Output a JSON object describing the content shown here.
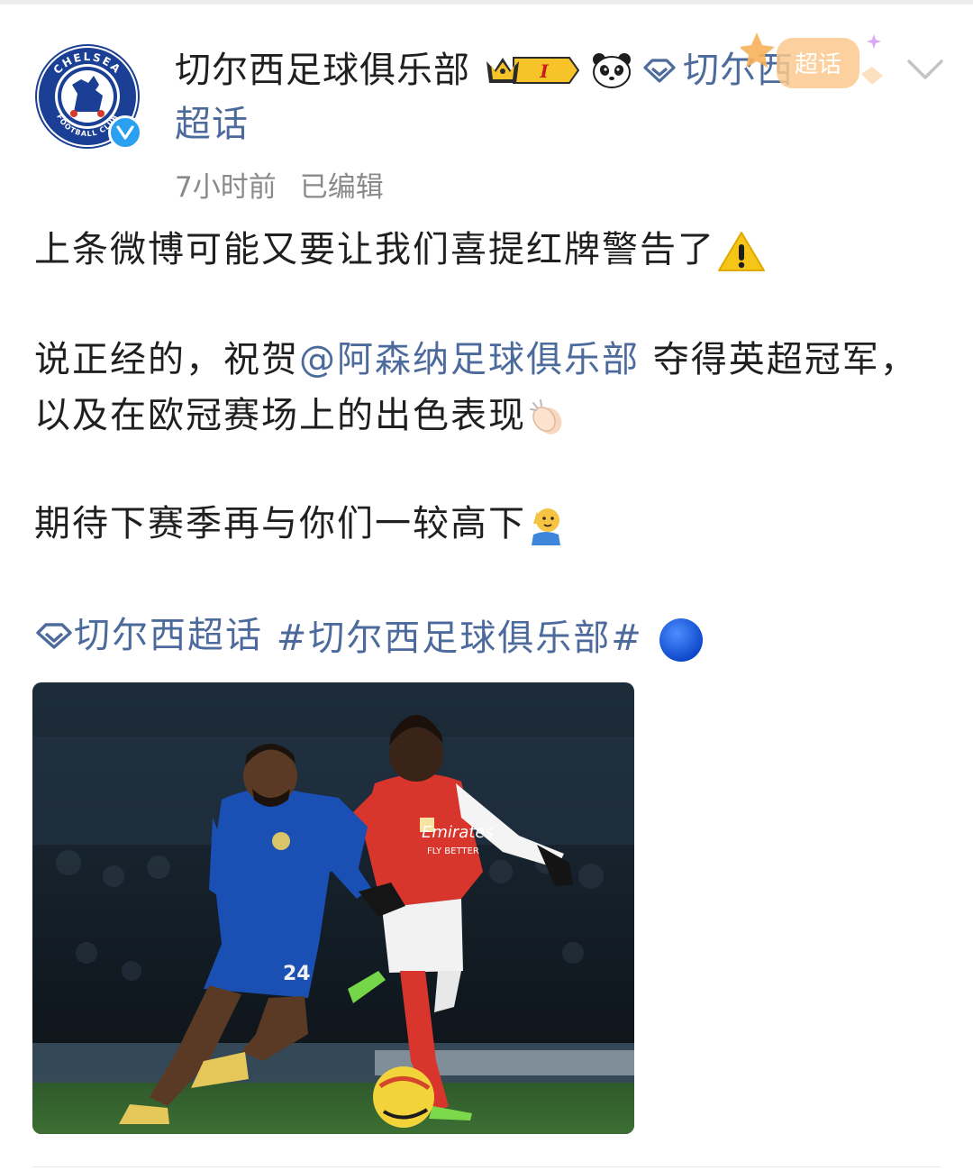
{
  "post": {
    "author_name": "切尔西足球俱乐部",
    "badge_level": "I",
    "topic_inline": "切尔西",
    "topic_second_line": "超话",
    "sticker_label": "超话",
    "time": "7小时前",
    "edited": "已编辑",
    "text": {
      "line1": "上条微博可能又要让我们喜提红牌警告了",
      "line2a": "说正经的，祝贺",
      "mention": "@阿森纳足球俱乐部",
      "line2b": " 夺得英超冠军，以及在欧冠赛场上的出色表现",
      "line3": "期待下赛季再与你们一较高下",
      "super_topic": "切尔西超话",
      "hashtag": " #切尔西足球俱乐部# "
    },
    "avatar_text": {
      "top": "CHELSEA",
      "bottom": "FOOTBALL CLUB"
    },
    "photo_text": {
      "sponsor": "Emirates",
      "sponsor_sub": "FLY BETTER",
      "home_number": "24"
    }
  },
  "icons": [
    "chelsea-crest-avatar",
    "verified-icon",
    "crown-badge-icon",
    "panda-icon",
    "super-topic-icon",
    "super-topic-sticker",
    "chevron-down-icon",
    "warning-emoji",
    "clap-emoji",
    "salute-emoji",
    "blue-circle-emoji"
  ],
  "colors": {
    "link": "#4c6b9c",
    "meta": "#8a8a8a",
    "text": "#1f1f1f",
    "verified": "#2aa0f0"
  }
}
